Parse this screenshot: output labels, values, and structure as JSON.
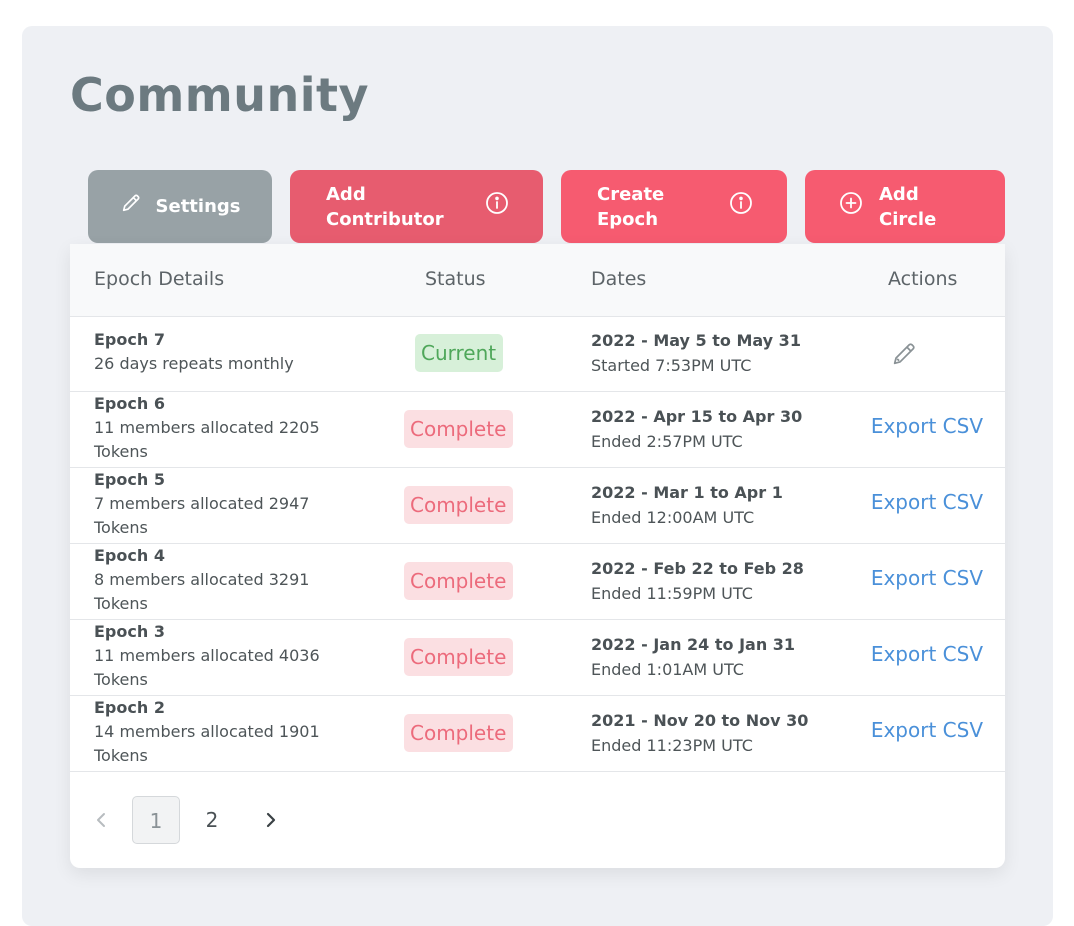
{
  "page": {
    "title": "Community"
  },
  "toolbar": {
    "settings_label": "Settings",
    "add_contributor_label": "Add\nContributor",
    "create_epoch_label": "Create\nEpoch",
    "add_circle_label": "Add\nCircle"
  },
  "table": {
    "headers": {
      "details": "Epoch Details",
      "status": "Status",
      "dates": "Dates",
      "actions": "Actions"
    },
    "rows": [
      {
        "name": "Epoch 7",
        "desc": "26 days repeats monthly",
        "status": "Current",
        "range": "2022 - May 5 to May 31",
        "time": "Started 7:53PM UTC",
        "action": ""
      },
      {
        "name": "Epoch 6",
        "desc": "11 members allocated 2205 Tokens",
        "status": "Complete",
        "range": "2022 - Apr 15 to Apr 30",
        "time": "Ended 2:57PM UTC",
        "action": "Export CSV"
      },
      {
        "name": "Epoch 5",
        "desc": "7 members allocated 2947 Tokens",
        "status": "Complete",
        "range": "2022 - Mar 1 to Apr 1",
        "time": "Ended 12:00AM UTC",
        "action": "Export CSV"
      },
      {
        "name": "Epoch 4",
        "desc": "8 members allocated 3291 Tokens",
        "status": "Complete",
        "range": "2022 - Feb 22 to Feb 28",
        "time": "Ended 11:59PM UTC",
        "action": "Export CSV"
      },
      {
        "name": "Epoch 3",
        "desc": "11 members allocated 4036 Tokens",
        "status": "Complete",
        "range": "2022 - Jan 24 to Jan 31",
        "time": "Ended 1:01AM UTC",
        "action": "Export CSV"
      },
      {
        "name": "Epoch 2",
        "desc": "14 members allocated 1901 Tokens",
        "status": "Complete",
        "range": "2021 - Nov 20 to Nov 30",
        "time": "Ended 11:23PM UTC",
        "action": "Export CSV"
      }
    ]
  },
  "pagination": {
    "pages": [
      "1",
      "2"
    ],
    "current": "1"
  },
  "colors": {
    "settings_button": "#98a2a6",
    "contributor_button": "#e75c6f",
    "primary_button": "#f65b70",
    "current_badge": "#d7f0d9",
    "complete_badge": "#fbdfe2",
    "link": "#4a90d9"
  },
  "icons": {
    "settings": "pencil-icon",
    "info": "info-icon",
    "add": "plus-circle-icon",
    "edit": "pencil-icon",
    "prev": "chevron-left-icon",
    "next": "chevron-right-icon"
  }
}
